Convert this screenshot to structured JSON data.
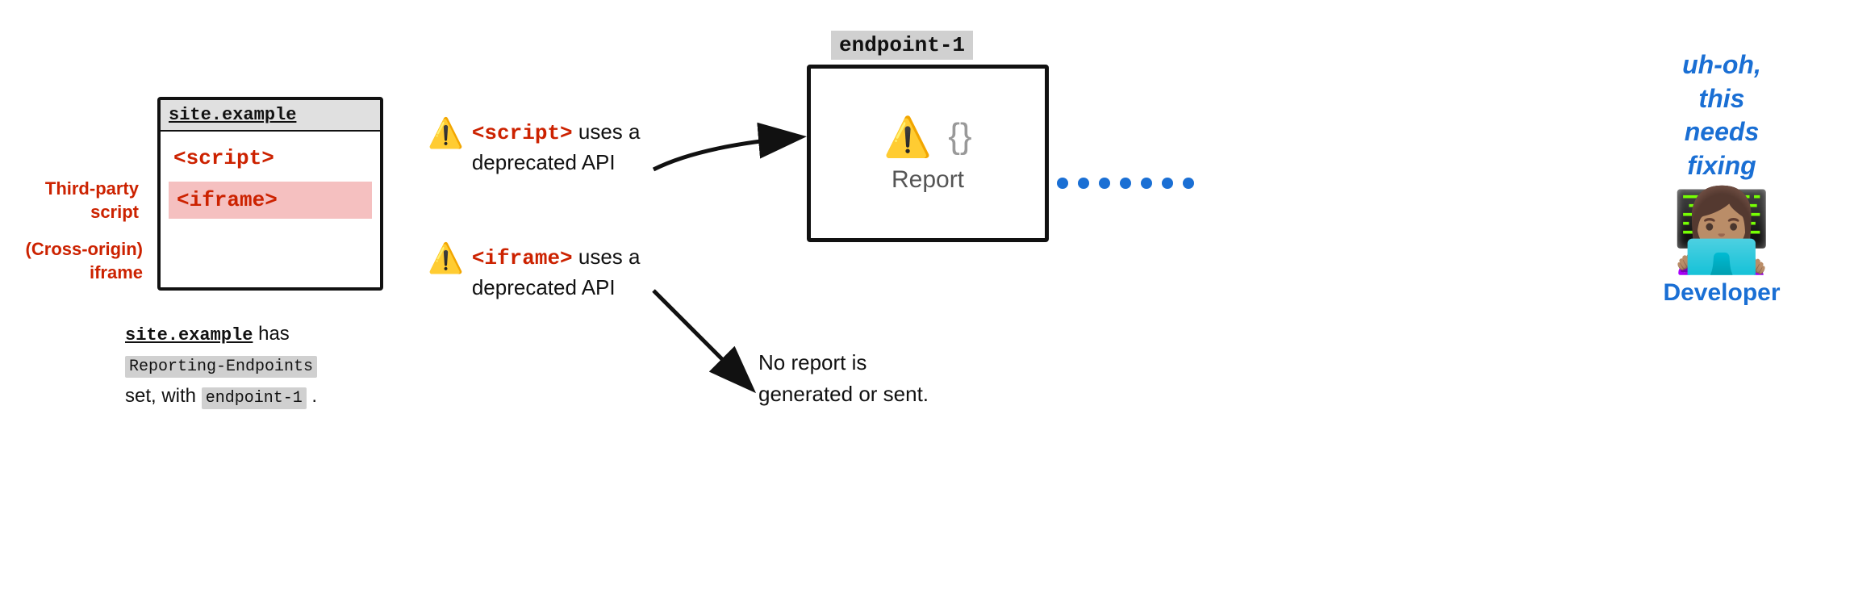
{
  "browser": {
    "title": "site.example",
    "script_tag": "<script>",
    "iframe_tag": "<iframe>"
  },
  "labels": {
    "third_party": "Third-party\nscript",
    "cross_origin": "(Cross-origin)\niframe"
  },
  "bottom_description": {
    "part1": "site.example",
    "part2": " has\n",
    "code1": "Reporting-Endpoints",
    "part3": "\nset, with ",
    "code2": "endpoint-1",
    "part4": "."
  },
  "warnings": [
    {
      "tag": "<script>",
      "text_suffix": " uses a\ndeprecated API"
    },
    {
      "tag": "<iframe>",
      "text_suffix": " uses a\ndeprecated API"
    }
  ],
  "endpoint": {
    "label": "endpoint-1",
    "report_label": "Report"
  },
  "no_report": {
    "text": "No report is\ngenerated or sent."
  },
  "developer": {
    "uh_oh": "uh-oh,\nthis\nneeds\nfixing",
    "label": "Developer"
  }
}
